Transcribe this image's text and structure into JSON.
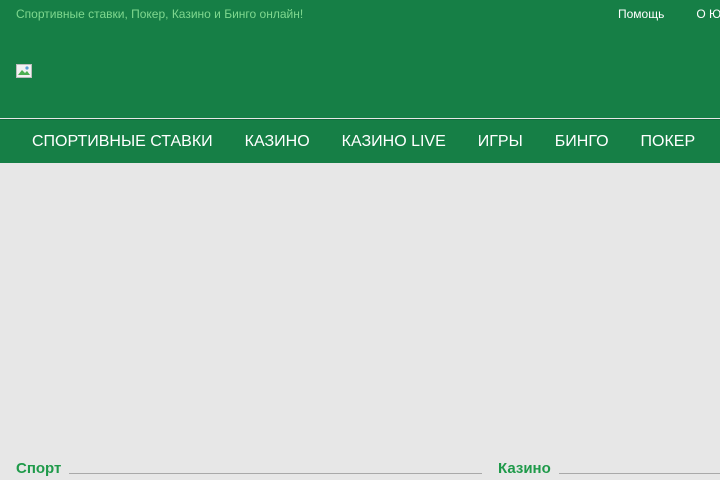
{
  "header": {
    "tagline": "Спортивные ставки, Покер, Казино и Бинго онлайн!",
    "top_links": [
      {
        "label": "Помощь"
      },
      {
        "label": "О Ю"
      }
    ],
    "logo_icon": "broken-image-icon"
  },
  "nav": {
    "items": [
      {
        "label": "СПОРТИВНЫЕ СТАВКИ"
      },
      {
        "label": "КАЗИНО"
      },
      {
        "label": "КАЗИНО LIVE"
      },
      {
        "label": "ИГРЫ"
      },
      {
        "label": "БИНГО"
      },
      {
        "label": "ПОКЕР"
      }
    ]
  },
  "sections": [
    {
      "title": "Спорт"
    },
    {
      "title": "Казино"
    }
  ],
  "colors": {
    "header_bg": "#167f46",
    "tagline": "#7fd88f",
    "section_title": "#1f9a4a",
    "page_bg": "#e7e7e7"
  }
}
